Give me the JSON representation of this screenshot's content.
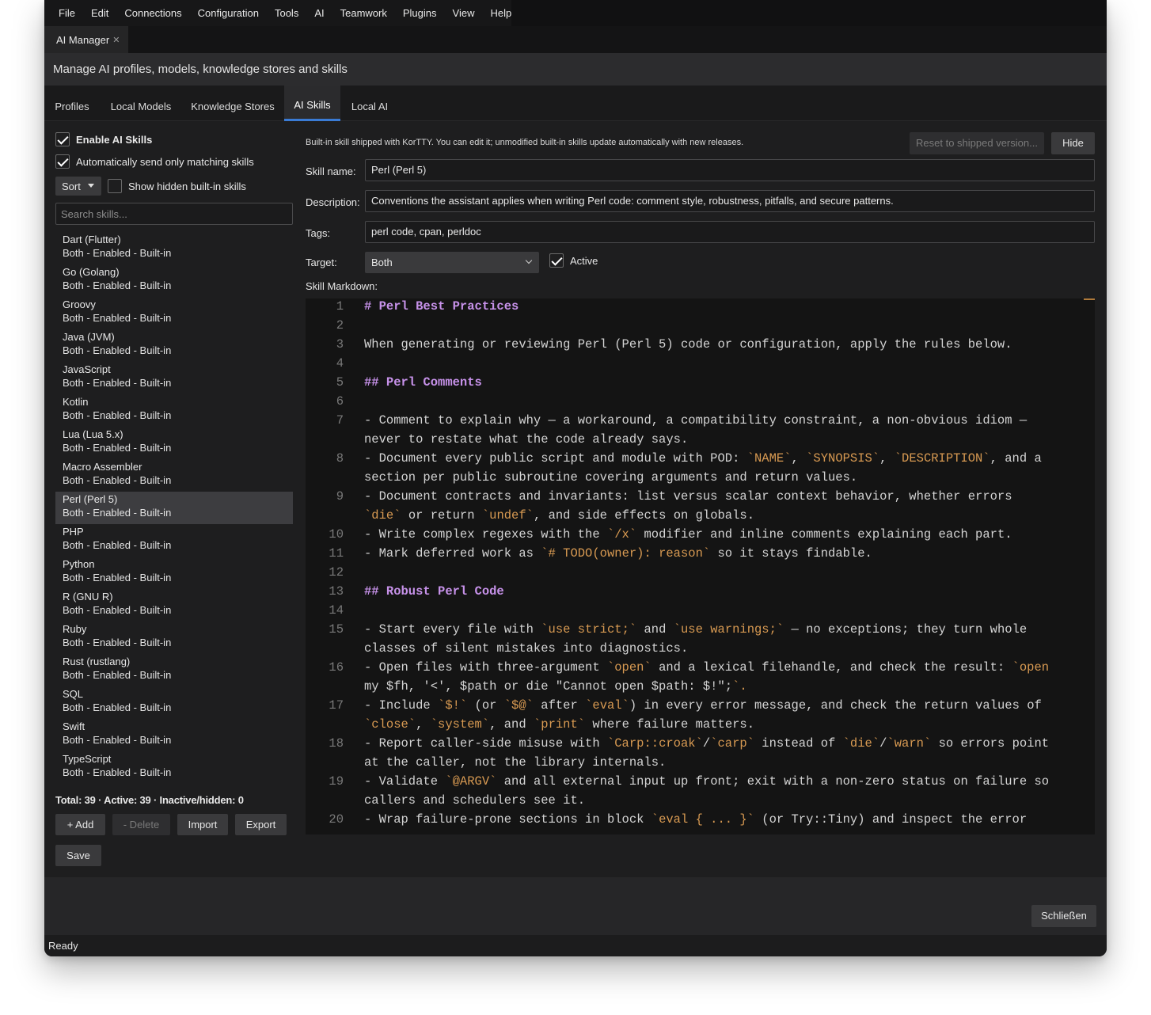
{
  "menu": [
    "File",
    "Edit",
    "Connections",
    "Configuration",
    "Tools",
    "AI",
    "Teamwork",
    "Plugins",
    "View",
    "Help"
  ],
  "doc_tab": {
    "label": "AI Manager",
    "close": "✕"
  },
  "header": {
    "title": "Manage AI profiles, models, knowledge stores and skills"
  },
  "tabs": [
    "Profiles",
    "Local Models",
    "Knowledge Stores",
    "AI Skills",
    "Local AI"
  ],
  "active_tab": "AI Skills",
  "left": {
    "enable_label": "Enable AI Skills",
    "auto_label": "Automatically send only matching skills",
    "sort_label": "Sort",
    "show_hidden_label": "Show hidden built-in skills",
    "search_placeholder": "Search skills...",
    "skills": [
      {
        "name": "",
        "sub": "Both - Enabled - Built-in"
      },
      {
        "name": "Dart (Flutter)",
        "sub": "Both - Enabled - Built-in"
      },
      {
        "name": "Go (Golang)",
        "sub": "Both - Enabled - Built-in"
      },
      {
        "name": "Groovy",
        "sub": "Both - Enabled - Built-in"
      },
      {
        "name": "Java (JVM)",
        "sub": "Both - Enabled - Built-in"
      },
      {
        "name": "JavaScript",
        "sub": "Both - Enabled - Built-in"
      },
      {
        "name": "Kotlin",
        "sub": "Both - Enabled - Built-in"
      },
      {
        "name": "Lua (Lua 5.x)",
        "sub": "Both - Enabled - Built-in"
      },
      {
        "name": "Macro Assembler",
        "sub": "Both - Enabled - Built-in"
      },
      {
        "name": "Perl (Perl 5)",
        "sub": "Both - Enabled - Built-in"
      },
      {
        "name": "PHP",
        "sub": "Both - Enabled - Built-in"
      },
      {
        "name": "Python",
        "sub": "Both - Enabled - Built-in"
      },
      {
        "name": "R (GNU R)",
        "sub": "Both - Enabled - Built-in"
      },
      {
        "name": "Ruby",
        "sub": "Both - Enabled - Built-in"
      },
      {
        "name": "Rust (rustlang)",
        "sub": "Both - Enabled - Built-in"
      },
      {
        "name": "SQL",
        "sub": "Both - Enabled - Built-in"
      },
      {
        "name": "Swift",
        "sub": "Both - Enabled - Built-in"
      },
      {
        "name": "TypeScript",
        "sub": "Both - Enabled - Built-in"
      }
    ],
    "selected_skill": "Perl (Perl 5)",
    "totals": "Total: 39 · Active: 39 · Inactive/hidden: 0",
    "buttons": {
      "add": "+ Add",
      "delete": "- Delete",
      "import": "Import",
      "export": "Export",
      "save": "Save"
    }
  },
  "right": {
    "info": "Built-in skill shipped with KorTTY. You can edit it; unmodified built-in skills update automatically with new releases.",
    "reset_label": "Reset to shipped version...",
    "hide_label": "Hide",
    "skill_name_label": "Skill name:",
    "skill_name": "Perl (Perl 5)",
    "description_label": "Description:",
    "description": "Conventions the assistant applies when writing Perl code: comment style, robustness, pitfalls, and secure patterns.",
    "tags_label": "Tags:",
    "tags": "perl code, cpan, perldoc",
    "target_label": "Target:",
    "target": "Both",
    "active_label": "Active",
    "markdown_label": "Skill Markdown:",
    "gutter": [
      "1",
      "2",
      "3",
      "4",
      "5",
      "6",
      "7",
      "",
      "8",
      "",
      "9",
      "",
      "10",
      "11",
      "12",
      "13",
      "14",
      "15",
      "",
      "16",
      "",
      "17",
      "",
      "18",
      "",
      "19",
      "",
      "20"
    ],
    "code_lines": [
      "# Perl Best Practices",
      "",
      "When generating or reviewing Perl (Perl 5) code or configuration, apply the rules below.",
      "",
      "## Perl Comments",
      "",
      "- Comment to explain why — a workaround, a compatibility constraint, a non-obvious idiom —",
      "never to restate what the code already says.",
      "- Document every public script and module with POD: `NAME`, `SYNOPSIS`, `DESCRIPTION`, and a",
      "section per public subroutine covering arguments and return values.",
      "- Document contracts and invariants: list versus scalar context behavior, whether errors",
      "`die` or return `undef`, and side effects on globals.",
      "- Write complex regexes with the `/x` modifier and inline comments explaining each part.",
      "- Mark deferred work as `# TODO(owner): reason` so it stays findable.",
      "",
      "## Robust Perl Code",
      "",
      "- Start every file with `use strict;` and `use warnings;` — no exceptions; they turn whole",
      "classes of silent mistakes into diagnostics.",
      "- Open files with three-argument `open` and a lexical filehandle, and check the result: `open",
      "my $fh, '<', $path or die \"Cannot open $path: $!\";`.",
      "- Include `$!` (or `$@` after `eval`) in every error message, and check the return values of",
      "`close`, `system`, and `print` where failure matters.",
      "- Report caller-side misuse with `Carp::croak`/`carp` instead of `die`/`warn` so errors point",
      "at the caller, not the library internals.",
      "- Validate `@ARGV` and all external input up front; exit with a non-zero status on failure so",
      "callers and schedulers see it.",
      "- Wrap failure-prone sections in block `eval { ... }` (or Try::Tiny) and inspect the error"
    ]
  },
  "close_label": "Schließen",
  "status": "Ready",
  "colors": {
    "accent": "#3a7bd5",
    "heading": "#c792ea",
    "code_span": "#d89a52"
  }
}
